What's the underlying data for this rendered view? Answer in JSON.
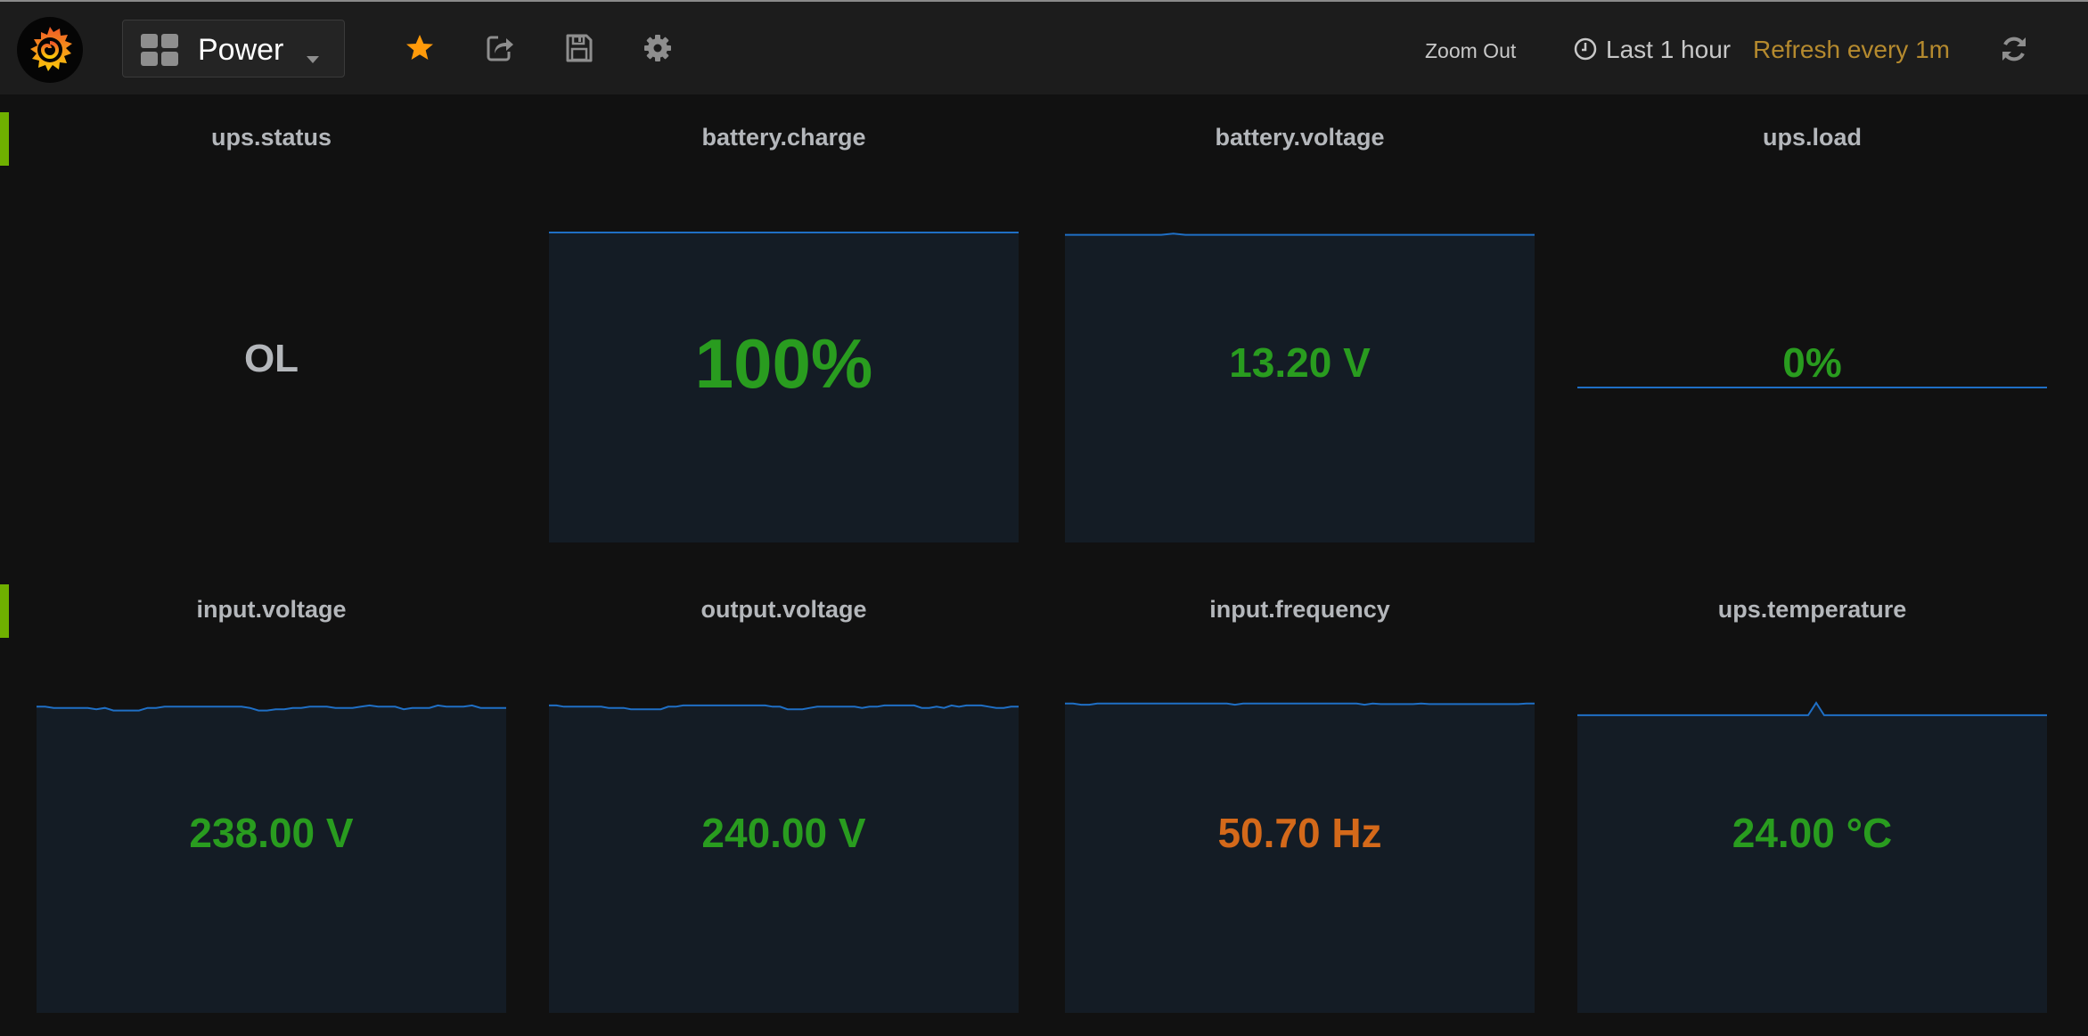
{
  "header": {
    "dashboard_title": "Power",
    "zoom_out_label": "Zoom Out",
    "time_range_label": "Last 1 hour",
    "refresh_label": "Refresh every 1m",
    "icons": [
      "grafana-logo",
      "dashboard-grid-icon",
      "star-icon",
      "share-icon",
      "save-icon",
      "gear-icon",
      "clock-icon",
      "refresh-icon"
    ]
  },
  "colors": {
    "ok_green": "#299c1f",
    "warn_orange": "#d4691a",
    "neutral_gray": "#b4b7bb",
    "sparkline_blue": "#1f6fc5",
    "sparkline_fill": "#141c25",
    "favorite_orange": "#ff9a0a",
    "refresh_amber": "#b58a2e",
    "row_marker_green": "#6fb000"
  },
  "rows": [
    {
      "panels": [
        {
          "title": "ups.status",
          "value": "OL",
          "color": "neutral",
          "sparkline": null
        },
        {
          "title": "battery.charge",
          "value": "100%",
          "color": "ok",
          "sparkline": {
            "values": [
              100,
              100,
              100,
              100,
              100,
              100,
              100,
              100,
              100,
              100,
              100,
              100,
              100,
              100,
              100,
              100,
              100,
              100,
              100,
              100
            ],
            "min": 0,
            "max": 100,
            "filled": true
          }
        },
        {
          "title": "battery.voltage",
          "value": "13.20 V",
          "color": "ok",
          "sparkline": {
            "values": [
              13.2,
              13.2,
              13.2,
              13.2,
              13.2,
              13.2,
              13.2,
              13.2,
              13.2,
              13.25,
              13.2,
              13.2,
              13.2,
              13.2,
              13.2,
              13.2,
              13.2,
              13.2,
              13.2,
              13.2,
              13.2,
              13.2,
              13.2,
              13.2,
              13.2,
              13.2,
              13.2,
              13.2,
              13.2,
              13.2,
              13.2,
              13.2,
              13.2,
              13.2,
              13.2,
              13.2,
              13.2,
              13.2,
              13.2,
              13.2
            ],
            "min": 0,
            "max": 13.3,
            "filled": true
          }
        },
        {
          "title": "ups.load",
          "value": "0%",
          "color": "ok",
          "sparkline": {
            "values": [
              0,
              0,
              0,
              0,
              0,
              0,
              0,
              0,
              0,
              0
            ],
            "min": -1,
            "max": 1,
            "filled": false
          }
        }
      ]
    },
    {
      "panels": [
        {
          "title": "input.voltage",
          "value": "238.00 V",
          "color": "ok",
          "sparkline": {
            "values": [
              240,
              240,
              239,
              239,
              239,
              239,
              239,
              238,
              239,
              237,
              237,
              237,
              237,
              239,
              239,
              240,
              240,
              240,
              240,
              240,
              240,
              240,
              240,
              240,
              240,
              239,
              237,
              237,
              238,
              238,
              239,
              239,
              240,
              240,
              240,
              239,
              239,
              239,
              240,
              241,
              240,
              240,
              240,
              238,
              239,
              239,
              239,
              241,
              240,
              240,
              240,
              241,
              239,
              239,
              239,
              239
            ],
            "min": 0,
            "max": 243,
            "filled": true
          }
        },
        {
          "title": "output.voltage",
          "value": "240.00 V",
          "color": "ok",
          "sparkline": {
            "values": [
              241,
              241,
              240,
              240,
              240,
              240,
              240,
              240,
              239,
              239,
              239,
              238,
              238,
              238,
              238,
              238,
              240,
              240,
              241,
              241,
              241,
              241,
              241,
              241,
              241,
              241,
              241,
              241,
              241,
              241,
              240,
              240,
              238,
              238,
              238,
              239,
              240,
              240,
              240,
              240,
              240,
              240,
              239,
              240,
              240,
              241,
              241,
              241,
              241,
              241,
              239,
              239,
              240,
              239,
              241,
              240,
              241,
              241,
              241,
              240,
              239,
              239,
              240,
              240
            ],
            "min": 0,
            "max": 243,
            "filled": true
          }
        },
        {
          "title": "input.frequency",
          "value": "50.70 Hz",
          "color": "warn",
          "sparkline": {
            "values": [
              50.8,
              50.8,
              50.6,
              50.6,
              50.8,
              50.8,
              50.8,
              50.8,
              50.8,
              50.8,
              50.8,
              50.8,
              50.8,
              50.8,
              50.8,
              50.8,
              50.8,
              50.8,
              50.8,
              50.8,
              50.8,
              50.6,
              50.8,
              50.8,
              50.8,
              50.8,
              50.8,
              50.8,
              50.8,
              50.8,
              50.8,
              50.8,
              50.8,
              50.8,
              50.8,
              50.8,
              50.8,
              50.6,
              50.8,
              50.7,
              50.7,
              50.7,
              50.7,
              50.7,
              50.8,
              50.7,
              50.7,
              50.7,
              50.7,
              50.7,
              50.7,
              50.7,
              50.7,
              50.7,
              50.7,
              50.7,
              50.7,
              50.8,
              50.8
            ],
            "min": 0,
            "max": 50.9,
            "filled": true
          }
        },
        {
          "title": "ups.temperature",
          "value": "24.00 °C",
          "color": "ok",
          "sparkline": {
            "values": [
              24,
              24,
              24,
              24,
              24,
              24,
              24,
              24,
              24,
              24,
              24,
              24,
              24,
              24,
              24,
              24,
              24,
              24,
              24,
              24,
              24,
              24,
              24,
              24,
              24,
              24,
              24,
              24,
              24,
              24,
              25,
              24,
              24,
              24,
              24,
              24,
              24,
              24,
              24,
              24,
              24,
              24,
              24,
              24,
              24,
              24,
              24,
              24,
              24,
              24,
              24,
              24,
              24,
              24,
              24,
              24,
              24,
              24,
              24,
              24
            ],
            "min": 0,
            "max": 25,
            "filled": true
          }
        }
      ]
    }
  ]
}
